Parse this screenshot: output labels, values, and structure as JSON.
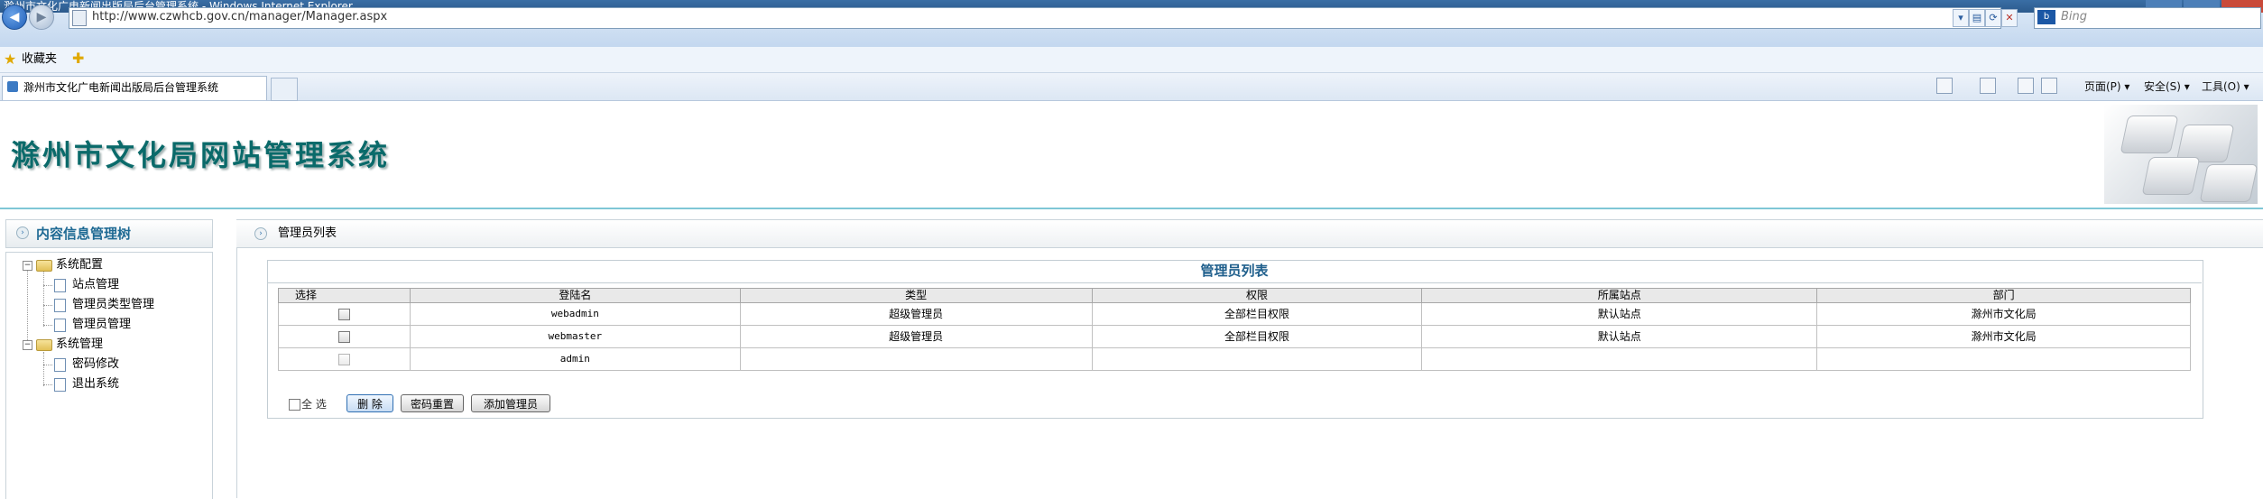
{
  "browser": {
    "window_title": "滁州市文化广电新闻出版局后台管理系统 - Windows Internet Explorer",
    "address": "http://www.czwhcb.gov.cn/manager/Manager.aspx",
    "search_placeholder": "Bing",
    "favorites_label": "收藏夹",
    "tab_label": "滁州市文化广电新闻出版局后台管理系统",
    "commands": {
      "page": "页面(P) ▾",
      "safety": "安全(S) ▾",
      "tools": "工具(O) ▾"
    }
  },
  "site": {
    "title": "滁州市文化局网站管理系统"
  },
  "sidebar": {
    "header": "内容信息管理树",
    "tree": [
      {
        "label": "系统配置",
        "children": [
          "站点管理",
          "管理员类型管理",
          "管理员管理"
        ]
      },
      {
        "label": "系统管理",
        "children": [
          "密码修改",
          "退出系统"
        ]
      }
    ]
  },
  "content": {
    "breadcrumb": "管理员列表",
    "panel_title": "管理员列表",
    "columns": [
      "选择",
      "登陆名",
      "类型",
      "权限",
      "所属站点",
      "部门"
    ],
    "rows": [
      {
        "login": "webadmin",
        "type": "超级管理员",
        "permission": "全部栏目权限",
        "site": "默认站点",
        "dept": "滁州市文化局"
      },
      {
        "login": "webmaster",
        "type": "超级管理员",
        "permission": "全部栏目权限",
        "site": "默认站点",
        "dept": "滁州市文化局"
      },
      {
        "login": "admin",
        "type": "",
        "permission": "",
        "site": "",
        "dept": ""
      }
    ],
    "select_all_label": "全 选",
    "buttons": {
      "delete": "删 除",
      "reset_password": "密码重置",
      "add_admin": "添加管理员"
    }
  }
}
